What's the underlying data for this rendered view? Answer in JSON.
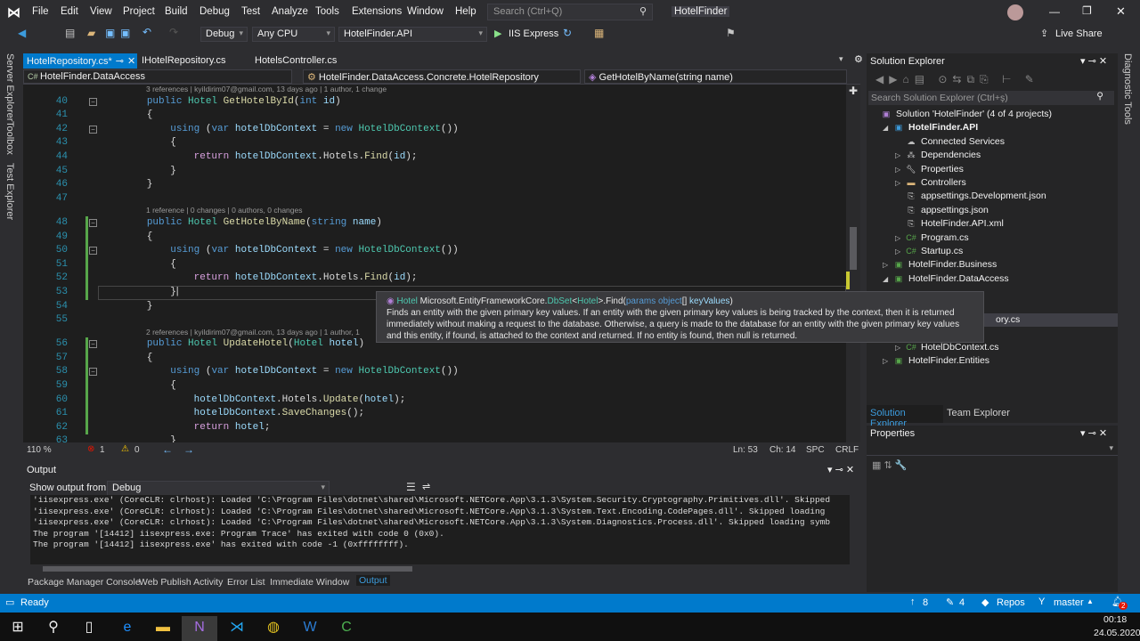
{
  "menu": [
    "File",
    "Edit",
    "View",
    "Project",
    "Build",
    "Debug",
    "Test",
    "Analyze",
    "Tools",
    "Extensions",
    "Window",
    "Help"
  ],
  "search_placeholder": "Search (Ctrl+Q)",
  "window_title": "HotelFinder",
  "live_share": "Live Share",
  "toolbar": {
    "config": "Debug",
    "platform": "Any CPU",
    "startup": "HotelFinder.API",
    "run": "IIS Express"
  },
  "left_tabs": [
    "Server Explorer",
    "Toolbox",
    "Test Explorer"
  ],
  "right_tabs": [
    "Diagnostic Tools"
  ],
  "tabs": [
    "HotelRepository.cs*",
    "IHotelRepository.cs",
    "HotelsController.cs"
  ],
  "nav": {
    "project": "HotelFinder.DataAccess",
    "class": "HotelFinder.DataAccess.Concrete.HotelRepository",
    "member": "GetHotelByName(string name)"
  },
  "code": [
    {
      "lens": "3 references | kyildirim07@gmail.com, 13 days ago | 1 author, 1 change"
    },
    {
      "n": "40",
      "fold": true,
      "tk": [
        [
          "x",
          "        "
        ],
        [
          "k",
          "public "
        ],
        [
          "t",
          "Hotel "
        ],
        [
          "m",
          "GetHotelById"
        ],
        [
          "x",
          "("
        ],
        [
          "k",
          "int "
        ],
        [
          "p",
          "id"
        ],
        [
          "x",
          ")"
        ]
      ]
    },
    {
      "n": "41",
      "tk": [
        [
          "x",
          "        {"
        ]
      ]
    },
    {
      "n": "42",
      "fold": true,
      "tk": [
        [
          "x",
          "            "
        ],
        [
          "k",
          "using "
        ],
        [
          "x",
          "("
        ],
        [
          "k",
          "var "
        ],
        [
          "p",
          "hotelDbContext"
        ],
        [
          "x",
          " = "
        ],
        [
          "k",
          "new "
        ],
        [
          "t",
          "HotelDbContext"
        ],
        [
          "x",
          "())"
        ]
      ]
    },
    {
      "n": "43",
      "tk": [
        [
          "x",
          "            {"
        ]
      ]
    },
    {
      "n": "44",
      "tk": [
        [
          "x",
          "                "
        ],
        [
          "c",
          "return "
        ],
        [
          "p",
          "hotelDbContext"
        ],
        [
          "x",
          ".Hotels."
        ],
        [
          "m",
          "Find"
        ],
        [
          "x",
          "("
        ],
        [
          "p",
          "id"
        ],
        [
          "x",
          ");"
        ]
      ]
    },
    {
      "n": "45",
      "tk": [
        [
          "x",
          "            }"
        ]
      ]
    },
    {
      "n": "46",
      "tk": [
        [
          "x",
          "        }"
        ]
      ]
    },
    {
      "n": "47",
      "tk": []
    },
    {
      "lens": "1 reference | 0 changes | 0 authors, 0 changes"
    },
    {
      "n": "48",
      "fold": true,
      "chg": true,
      "tk": [
        [
          "x",
          "        "
        ],
        [
          "k",
          "public "
        ],
        [
          "t",
          "Hotel "
        ],
        [
          "m",
          "GetHotelByName"
        ],
        [
          "x",
          "("
        ],
        [
          "k",
          "string "
        ],
        [
          "p",
          "name"
        ],
        [
          "x",
          ")"
        ]
      ]
    },
    {
      "n": "49",
      "chg": true,
      "tk": [
        [
          "x",
          "        {"
        ]
      ]
    },
    {
      "n": "50",
      "fold": true,
      "chg": true,
      "tk": [
        [
          "x",
          "            "
        ],
        [
          "k",
          "using "
        ],
        [
          "x",
          "("
        ],
        [
          "k",
          "var "
        ],
        [
          "p",
          "hotelDbContext"
        ],
        [
          "x",
          " = "
        ],
        [
          "k",
          "new "
        ],
        [
          "t",
          "HotelDbContext"
        ],
        [
          "x",
          "())"
        ]
      ]
    },
    {
      "n": "51",
      "chg": true,
      "tk": [
        [
          "x",
          "            {"
        ]
      ]
    },
    {
      "n": "52",
      "chg": true,
      "tk": [
        [
          "x",
          "                "
        ],
        [
          "c",
          "return "
        ],
        [
          "p",
          "hotelDbContext"
        ],
        [
          "x",
          ".Hotels."
        ],
        [
          "m",
          "Find"
        ],
        [
          "x",
          "("
        ],
        [
          "p",
          "id"
        ],
        [
          "x",
          ");"
        ]
      ]
    },
    {
      "n": "53",
      "chg": true,
      "cur": true,
      "tk": [
        [
          "x",
          "            }"
        ]
      ]
    },
    {
      "n": "54",
      "tk": [
        [
          "x",
          "        }"
        ]
      ]
    },
    {
      "n": "55",
      "tk": []
    },
    {
      "lens": "2 references | kyildirim07@gmail.com, 13 days ago | 1 author, 1"
    },
    {
      "n": "56",
      "fold": true,
      "chg": true,
      "tk": [
        [
          "x",
          "        "
        ],
        [
          "k",
          "public "
        ],
        [
          "t",
          "Hotel "
        ],
        [
          "m",
          "UpdateHotel"
        ],
        [
          "x",
          "("
        ],
        [
          "t",
          "Hotel "
        ],
        [
          "p",
          "hotel"
        ],
        [
          "x",
          ")"
        ]
      ]
    },
    {
      "n": "57",
      "chg": true,
      "tk": [
        [
          "x",
          "        {"
        ]
      ]
    },
    {
      "n": "58",
      "fold": true,
      "chg": true,
      "tk": [
        [
          "x",
          "            "
        ],
        [
          "k",
          "using "
        ],
        [
          "x",
          "("
        ],
        [
          "k",
          "var "
        ],
        [
          "p",
          "hotelDbContext"
        ],
        [
          "x",
          " = "
        ],
        [
          "k",
          "new "
        ],
        [
          "t",
          "HotelDbContext"
        ],
        [
          "x",
          "())"
        ]
      ]
    },
    {
      "n": "59",
      "chg": true,
      "tk": [
        [
          "x",
          "            {"
        ]
      ]
    },
    {
      "n": "60",
      "chg": true,
      "tk": [
        [
          "x",
          "                "
        ],
        [
          "p",
          "hotelDbContext"
        ],
        [
          "x",
          ".Hotels."
        ],
        [
          "m",
          "Update"
        ],
        [
          "x",
          "("
        ],
        [
          "p",
          "hotel"
        ],
        [
          "x",
          ");"
        ]
      ]
    },
    {
      "n": "61",
      "chg": true,
      "tk": [
        [
          "x",
          "                "
        ],
        [
          "p",
          "hotelDbContext"
        ],
        [
          "x",
          "."
        ],
        [
          "m",
          "SaveChanges"
        ],
        [
          "x",
          "();"
        ]
      ]
    },
    {
      "n": "62",
      "chg": true,
      "tk": [
        [
          "x",
          "                "
        ],
        [
          "c",
          "return "
        ],
        [
          "p",
          "hotel"
        ],
        [
          "x",
          ";"
        ]
      ]
    },
    {
      "n": "63",
      "tk": [
        [
          "x",
          "            }"
        ]
      ]
    }
  ],
  "tooltip": {
    "ret": "Hotel",
    "ns": "Microsoft.EntityFrameworkCore.",
    "cls": "DbSet",
    "lt": "<",
    "gen": "Hotel",
    "gt": ">",
    "meth": ".Find(",
    "kw": "params object",
    "arr": "[] ",
    "param": "keyValues",
    "close": ")",
    "desc": "Finds an entity with the given primary key values. If an entity with the given primary key values is being tracked by the context, then it is returned immediately without making a request to the database. Otherwise, a query is made to the database for an entity with the given primary key values and this entity, if found, is attached to the context and returned. If no entity is found, then null is returned."
  },
  "editor_status": {
    "zoom": "110 %",
    "errors": "1",
    "warnings": "0",
    "line": "Ln: 53",
    "col": "Ch: 14",
    "ws": "SPC",
    "eol": "CRLF"
  },
  "output": {
    "title": "Output",
    "show_from_label": "Show output from:",
    "source": "Debug",
    "lines": [
      "'iisexpress.exe' (CoreCLR: clrhost): Loaded 'C:\\Program Files\\dotnet\\shared\\Microsoft.NETCore.App\\3.1.3\\System.Security.Cryptography.Primitives.dll'. Skipped",
      "'iisexpress.exe' (CoreCLR: clrhost): Loaded 'C:\\Program Files\\dotnet\\shared\\Microsoft.NETCore.App\\3.1.3\\System.Text.Encoding.CodePages.dll'. Skipped loading",
      "'iisexpress.exe' (CoreCLR: clrhost): Loaded 'C:\\Program Files\\dotnet\\shared\\Microsoft.NETCore.App\\3.1.3\\System.Diagnostics.Process.dll'. Skipped loading symb",
      "The program '[14412] iisexpress.exe: Program Trace' has exited with code 0 (0x0).",
      "The program '[14412] iisexpress.exe' has exited with code -1 (0xffffffff)."
    ]
  },
  "bottom_tabs": [
    "Package Manager Console",
    "Web Publish Activity",
    "Error List",
    "Immediate Window",
    "Output"
  ],
  "solution_explorer": {
    "title": "Solution Explorer",
    "search_placeholder": "Search Solution Explorer (Ctrl+ş)",
    "items": [
      {
        "label": "Solution 'HotelFinder' (4 of 4 projects)",
        "lvl": 0,
        "exp": "",
        "icon": "sln"
      },
      {
        "label": "HotelFinder.API",
        "lvl": 1,
        "exp": "open",
        "icon": "web",
        "bold": true
      },
      {
        "label": "Connected Services",
        "lvl": 2,
        "exp": "",
        "icon": "cloud"
      },
      {
        "label": "Dependencies",
        "lvl": 2,
        "exp": "closed",
        "icon": "deps"
      },
      {
        "label": "Properties",
        "lvl": 2,
        "exp": "closed",
        "icon": "wrench"
      },
      {
        "label": "Controllers",
        "lvl": 2,
        "exp": "closed",
        "icon": "folder"
      },
      {
        "label": "appsettings.Development.json",
        "lvl": 2,
        "exp": "",
        "icon": "json"
      },
      {
        "label": "appsettings.json",
        "lvl": 2,
        "exp": "",
        "icon": "json"
      },
      {
        "label": "HotelFinder.API.xml",
        "lvl": 2,
        "exp": "",
        "icon": "xml"
      },
      {
        "label": "Program.cs",
        "lvl": 2,
        "exp": "closed",
        "icon": "cs"
      },
      {
        "label": "Startup.cs",
        "lvl": 2,
        "exp": "closed",
        "icon": "cs"
      },
      {
        "label": "HotelFinder.Business",
        "lvl": 1,
        "exp": "closed",
        "icon": "proj"
      },
      {
        "label": "HotelFinder.DataAccess",
        "lvl": 1,
        "exp": "open",
        "icon": "proj"
      },
      {
        "label": "",
        "lvl": 2,
        "exp": "",
        "icon": ""
      },
      {
        "label": "",
        "lvl": 2,
        "exp": "",
        "icon": ""
      },
      {
        "label": "ory.cs",
        "lvl": 2,
        "exp": "",
        "icon": "",
        "sel": true,
        "offset": true
      },
      {
        "label": "Migrations",
        "lvl": 2,
        "exp": "closed",
        "icon": "folder"
      },
      {
        "label": "HotelDbContext.cs",
        "lvl": 2,
        "exp": "closed",
        "icon": "cs"
      },
      {
        "label": "HotelFinder.Entities",
        "lvl": 1,
        "exp": "closed",
        "icon": "proj"
      }
    ],
    "tabs": [
      "Solution Explorer",
      "Team Explorer"
    ]
  },
  "properties": {
    "title": "Properties"
  },
  "statusbar": {
    "ready": "Ready",
    "up": "8",
    "edits": "4",
    "repos": "Repos",
    "branch": "master",
    "notifications": "2"
  },
  "clock": {
    "time": "00:18",
    "date": "24.05.2020"
  },
  "colors": {
    "accent": "#007acc",
    "editor_bg": "#1e1e1e"
  }
}
